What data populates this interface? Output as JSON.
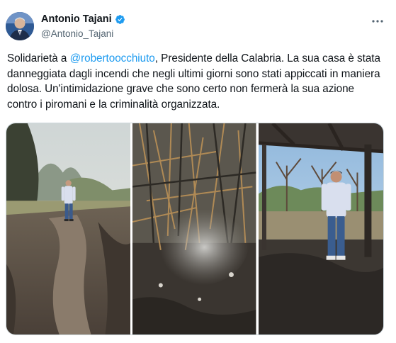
{
  "author": {
    "display_name": "Antonio Tajani",
    "handle": "@Antonio_Tajani",
    "avatar_icon": "profile-photo",
    "verified_icon": "verified-badge-icon",
    "verified_color": "#1d9bf0"
  },
  "menu": {
    "icon": "more-horizontal-icon"
  },
  "tweet": {
    "text_before_mention": "Solidarietà a ",
    "mention": "@robertoocchiuto",
    "text_after_mention": ", Presidente della Calabria. La sua casa è stata danneggiata dagli incendi che negli ultimi giorni sono stati appiccati in maniera dolosa. Un'intimidazione grave che sono certo non fermerà la sua azione contro i piromani e la criminalità organizzata."
  },
  "media": {
    "photos": [
      {
        "name": "photo-man-on-burned-path"
      },
      {
        "name": "photo-smoking-burned-grass"
      },
      {
        "name": "photo-man-under-burned-pergola"
      }
    ]
  },
  "colors": {
    "text": "#0f1419",
    "secondary_text": "#536471",
    "link": "#1d9bf0",
    "border": "#cfd9de"
  }
}
